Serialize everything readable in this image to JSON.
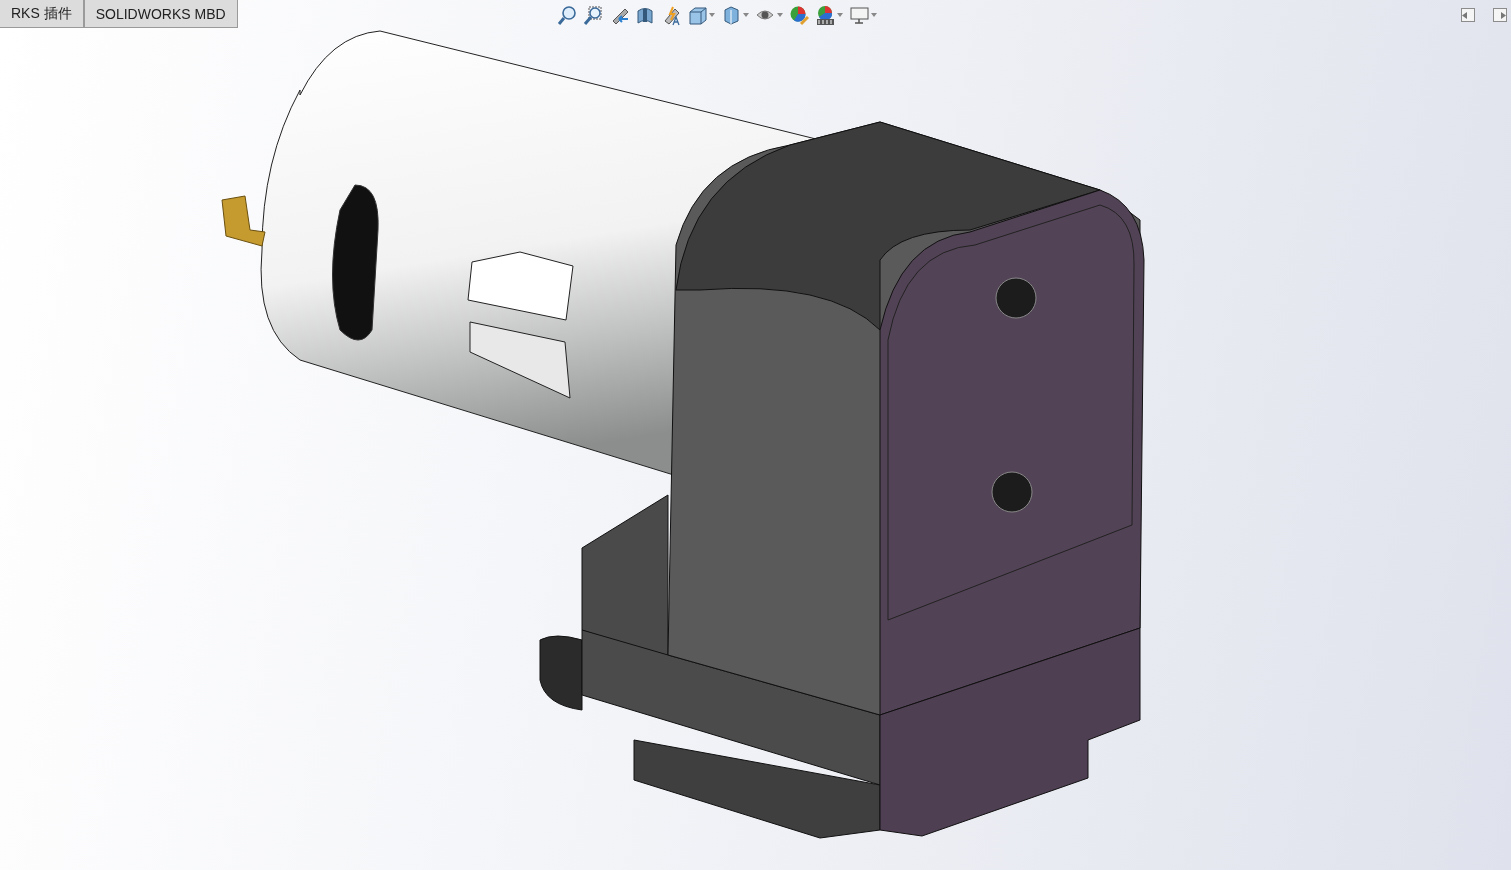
{
  "tabs": [
    {
      "label": "RKS 插件",
      "selected": false
    },
    {
      "label": "SOLIDWORKS MBD",
      "selected": false
    }
  ],
  "view_toolbar": [
    {
      "kind": "zoom-fit",
      "dropdown": false
    },
    {
      "kind": "zoom-area",
      "dropdown": false
    },
    {
      "kind": "previous-view",
      "dropdown": false
    },
    {
      "kind": "section",
      "dropdown": false
    },
    {
      "kind": "dynamic-annotation",
      "dropdown": false
    },
    {
      "kind": "view-orientation",
      "dropdown": true
    },
    {
      "kind": "display-style",
      "dropdown": true
    },
    {
      "kind": "hide-show",
      "dropdown": true
    },
    {
      "kind": "edit-appearance",
      "dropdown": false
    },
    {
      "kind": "scene",
      "dropdown": true
    },
    {
      "kind": "view-settings",
      "dropdown": true
    }
  ],
  "panel_toggles": [
    {
      "kind": "left"
    },
    {
      "kind": "right"
    }
  ]
}
